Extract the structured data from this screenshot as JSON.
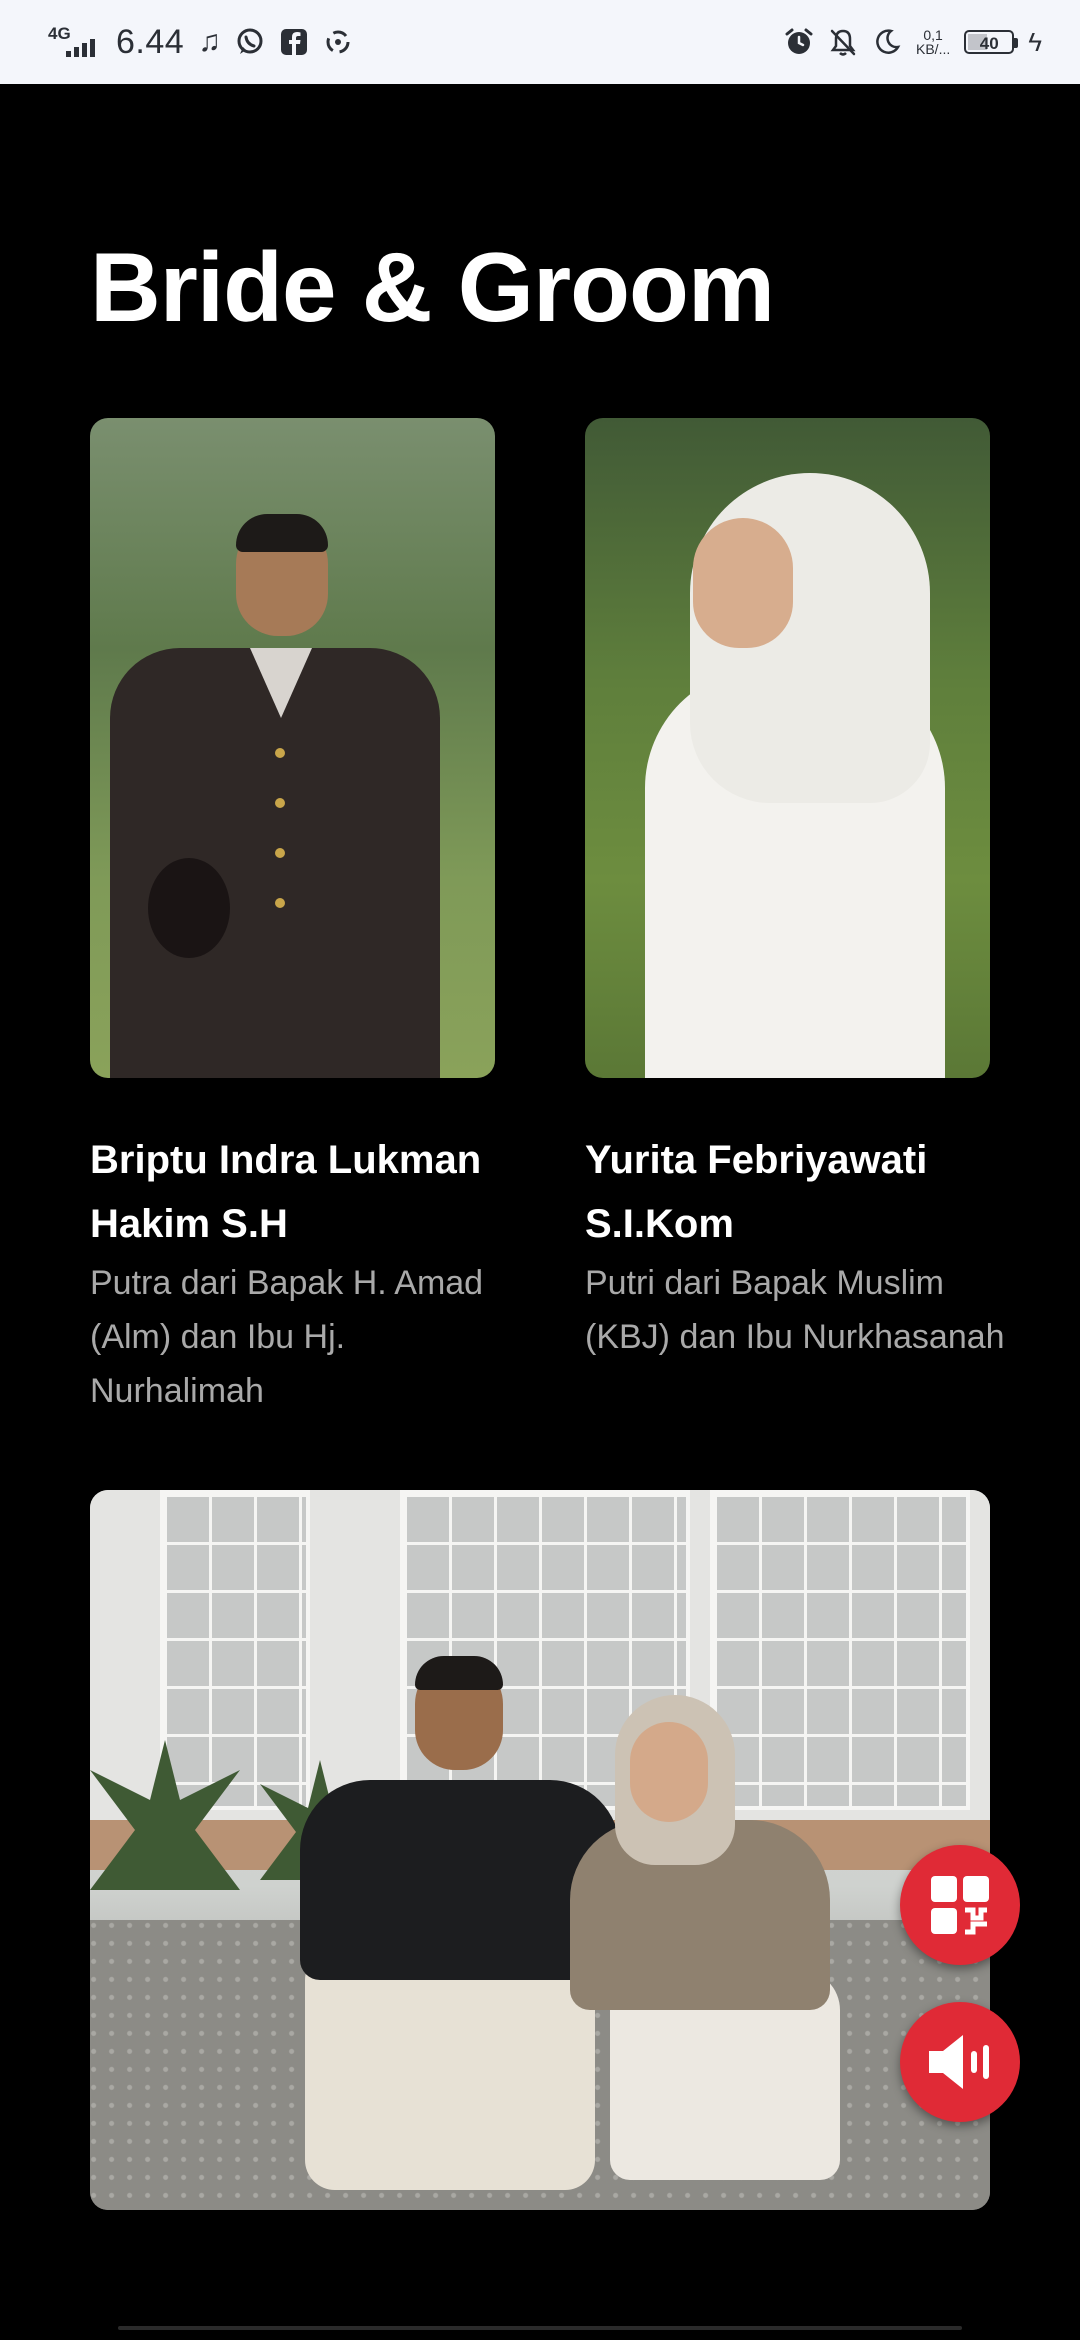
{
  "status_bar": {
    "network": "4G",
    "time": "6.44",
    "net_speed_value": "0,1",
    "net_speed_unit": "KB/...",
    "battery": "40",
    "left_icons": [
      "music-note-icon",
      "whatsapp-icon",
      "facebook-icon",
      "recycle-icon"
    ],
    "right_icons": [
      "alarm-icon",
      "notifications-off-icon",
      "moon-icon",
      "charging-icon"
    ]
  },
  "section": {
    "title": "Bride & Groom"
  },
  "groom": {
    "name": "Briptu Indra Lukman Hakim S.H",
    "parents": "Putra dari Bapak H. Amad (Alm) dan Ibu Hj. Nurhalimah"
  },
  "bride": {
    "name": "Yurita Febriyawati S.I.Kom",
    "parents": "Putri dari Bapak Muslim (KBJ) dan Ibu Nurkhasanah"
  },
  "fab": {
    "menu_icon": "grid-menu-icon",
    "sound_icon": "speaker-icon"
  },
  "colors": {
    "background": "#000000",
    "accent": "#e02a36",
    "muted_text": "#a9a9a9",
    "status_bar_bg": "#f4f6fb"
  }
}
